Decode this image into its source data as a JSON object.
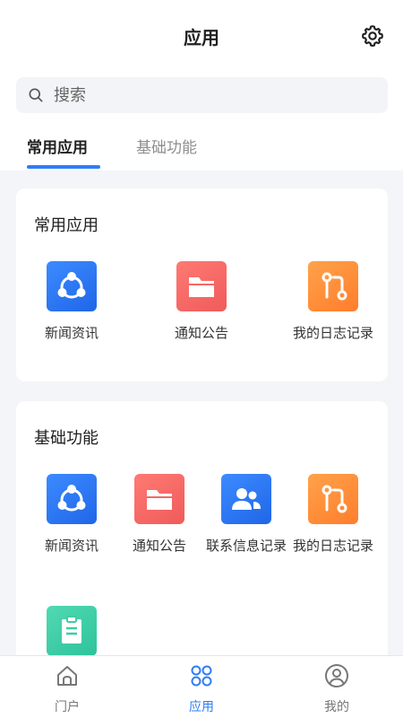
{
  "header": {
    "title": "应用"
  },
  "search": {
    "placeholder": "搜索"
  },
  "tabs": [
    {
      "label": "常用应用",
      "active": true
    },
    {
      "label": "基础功能",
      "active": false
    }
  ],
  "sections": [
    {
      "title": "常用应用",
      "apps": [
        {
          "label": "新闻资讯",
          "icon": "news-icon",
          "color": "#2f7df6"
        },
        {
          "label": "通知公告",
          "icon": "folder-icon",
          "color": "#f26a64"
        },
        {
          "label": "我的日志记录",
          "icon": "log-icon",
          "color": "#ff8a35"
        }
      ]
    },
    {
      "title": "基础功能",
      "apps": [
        {
          "label": "新闻资讯",
          "icon": "news-icon",
          "color": "#2f7df6"
        },
        {
          "label": "通知公告",
          "icon": "folder-icon",
          "color": "#f26a64"
        },
        {
          "label": "联系信息记录",
          "icon": "contacts-icon",
          "color": "#2f7df6"
        },
        {
          "label": "我的日志记录",
          "icon": "log-icon",
          "color": "#ff8a35"
        },
        {
          "label": "",
          "icon": "clipboard-icon",
          "color": "#3fcca5"
        }
      ]
    }
  ],
  "tabbar": {
    "items": [
      {
        "label": "门户",
        "icon": "home-icon",
        "active": false
      },
      {
        "label": "应用",
        "icon": "apps-grid-icon",
        "active": true
      },
      {
        "label": "我的",
        "icon": "profile-icon",
        "active": false
      }
    ]
  },
  "colors": {
    "accent": "#2f7df6",
    "background": "#f3f5f8"
  }
}
